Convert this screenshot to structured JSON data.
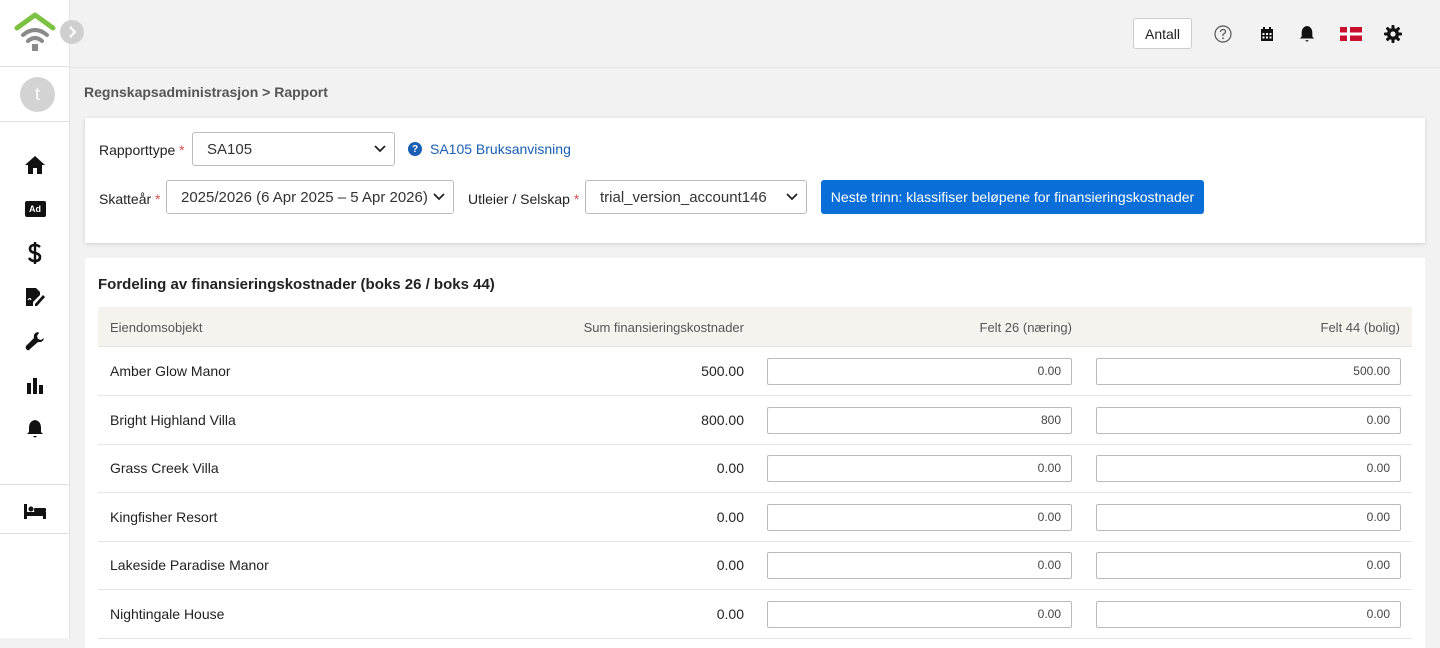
{
  "topbar": {
    "antall_label": "Antall",
    "icons": [
      "help-circle-icon",
      "calendar-icon",
      "bell-icon",
      "flag-icon",
      "gear-icon"
    ]
  },
  "user": {
    "avatar_initial": "t"
  },
  "sidebar": {
    "icons": [
      "home-icon",
      "ad-icon",
      "dollar-icon",
      "document-sign-icon",
      "wrench-icon",
      "bar-chart-icon",
      "bell-icon",
      "bed-icon"
    ],
    "ad_text": "Ad"
  },
  "breadcrumb": "Regnskapsadministrasjon > Rapport",
  "filters": {
    "report_type_label": "Rapporttype",
    "report_type_value": "SA105",
    "help_link": "SA105 Bruksanvisning",
    "tax_year_label": "Skatteår",
    "tax_year_value": "2025/2026 (6 Apr 2025 – 5 Apr 2026)",
    "landlord_label": "Utleier / Selskap",
    "landlord_value": "trial_version_account146",
    "next_step_button": "Neste trinn: klassifiser beløpene for finansieringskostnader",
    "required_mark": "*"
  },
  "table": {
    "title": "Fordeling av finansieringskostnader (boks 26 / boks 44)",
    "columns": [
      "Eiendomsobjekt",
      "Sum finansieringskostnader",
      "Felt 26 (næring)",
      "Felt 44 (bolig)"
    ],
    "rows": [
      {
        "property": "Amber Glow Manor",
        "sum": "500.00",
        "box26": "0.00",
        "box44": "500.00"
      },
      {
        "property": "Bright Highland Villa",
        "sum": "800.00",
        "box26": "800",
        "box44": "0.00"
      },
      {
        "property": "Grass Creek Villa",
        "sum": "0.00",
        "box26": "0.00",
        "box44": "0.00"
      },
      {
        "property": "Kingfisher Resort",
        "sum": "0.00",
        "box26": "0.00",
        "box44": "0.00"
      },
      {
        "property": "Lakeside Paradise Manor",
        "sum": "0.00",
        "box26": "0.00",
        "box44": "0.00"
      },
      {
        "property": "Nightingale House",
        "sum": "0.00",
        "box26": "0.00",
        "box44": "0.00"
      }
    ]
  },
  "colors": {
    "primary": "#0a6ed9",
    "logo_green": "#7cc242",
    "logo_grey": "#8a8a8a",
    "required": "#d9534f"
  }
}
